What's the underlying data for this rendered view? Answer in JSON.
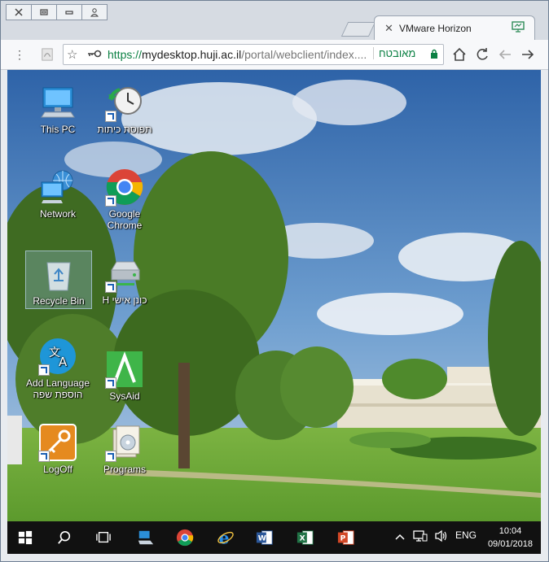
{
  "browser": {
    "tab_title": "VMware Horizon",
    "url_scheme": "https://",
    "url_host": "mydesktop.huji.ac.il",
    "url_path": "/portal/webclient/index....",
    "secure_label": "מאובטח"
  },
  "desktop": {
    "icons": [
      {
        "label": "This PC",
        "icon": "computer-icon"
      },
      {
        "label": "תפוסת כיתות",
        "icon": "clock-icon"
      },
      {
        "label": "Network",
        "icon": "network-icon"
      },
      {
        "label": "Google Chrome",
        "icon": "chrome-icon"
      },
      {
        "label": "Recycle Bin",
        "icon": "recycle-bin-icon"
      },
      {
        "label": "H כונן אישי",
        "icon": "drive-icon"
      },
      {
        "label": "Add Language הוספת שפה",
        "icon": "language-icon"
      },
      {
        "label": "SysAid",
        "icon": "sysaid-icon"
      },
      {
        "label": "LogOff",
        "icon": "key-icon"
      },
      {
        "label": "Programs",
        "icon": "programs-icon"
      }
    ]
  },
  "taskbar": {
    "language": "ENG",
    "time": "10:04",
    "date": "09/01/2018"
  }
}
